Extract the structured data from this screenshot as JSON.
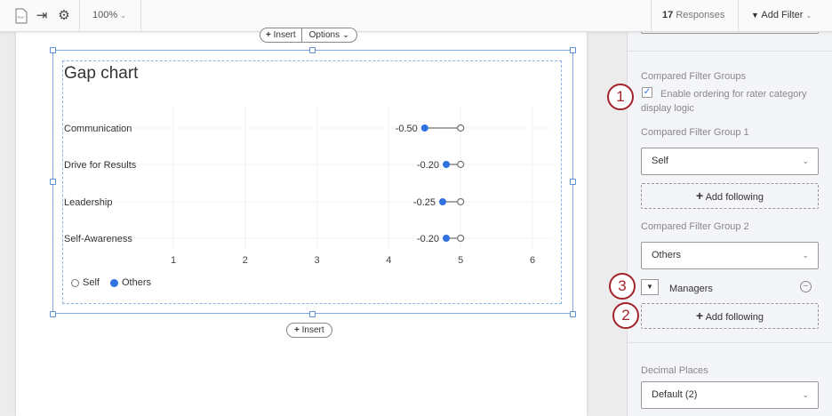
{
  "toolbar": {
    "zoom": "100%",
    "responses_count": "17",
    "responses_label": "Responses",
    "add_filter": "Add Filter",
    "icons": [
      "pdf-icon",
      "export-icon",
      "gear-icon"
    ]
  },
  "widget_controls": {
    "insert": "Insert",
    "options": "Options",
    "insert_below": "Insert"
  },
  "chart_data": {
    "type": "gap",
    "title": "Gap chart",
    "categories": [
      "Communication",
      "Drive for Results",
      "Leadership",
      "Self-Awareness"
    ],
    "series": [
      {
        "name": "Self",
        "values": [
          5,
          5,
          5,
          5
        ]
      },
      {
        "name": "Others",
        "values": [
          4.5,
          4.8,
          4.75,
          4.8
        ]
      }
    ],
    "gap_labels": [
      "-0.50",
      "-0.20",
      "-0.25",
      "-0.20"
    ],
    "xticks": [
      "1",
      "2",
      "3",
      "4",
      "5",
      "6"
    ],
    "xlim": [
      1,
      6
    ],
    "legend": "bottom-left",
    "colors": {
      "Self": "#777777",
      "Others": "#2f73e0"
    }
  },
  "panel": {
    "compared_heading": "Compared Filter Groups",
    "enable_ordering": "Enable ordering for rater category display logic",
    "group1_label": "Compared Filter Group 1",
    "group1_value": "Self",
    "add_following": "Add following",
    "group2_label": "Compared Filter Group 2",
    "group2_value": "Others",
    "managers": "Managers",
    "decimal_label": "Decimal Places",
    "decimal_value": "Default (2)"
  },
  "callouts": [
    "1",
    "2",
    "3"
  ]
}
